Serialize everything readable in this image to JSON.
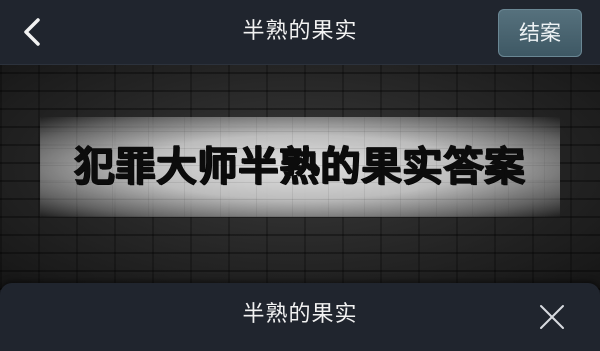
{
  "header": {
    "title": "半熟的果实",
    "close_case_label": "结案",
    "back_icon": "chevron-left-icon"
  },
  "banner": {
    "headline": "犯罪大师半熟的果实答案"
  },
  "sheet": {
    "title": "半熟的果实",
    "close_icon": "close-icon"
  },
  "colors": {
    "bar_background": "#20252e",
    "button_background": "#4a6672",
    "text": "#f2f2f2"
  }
}
